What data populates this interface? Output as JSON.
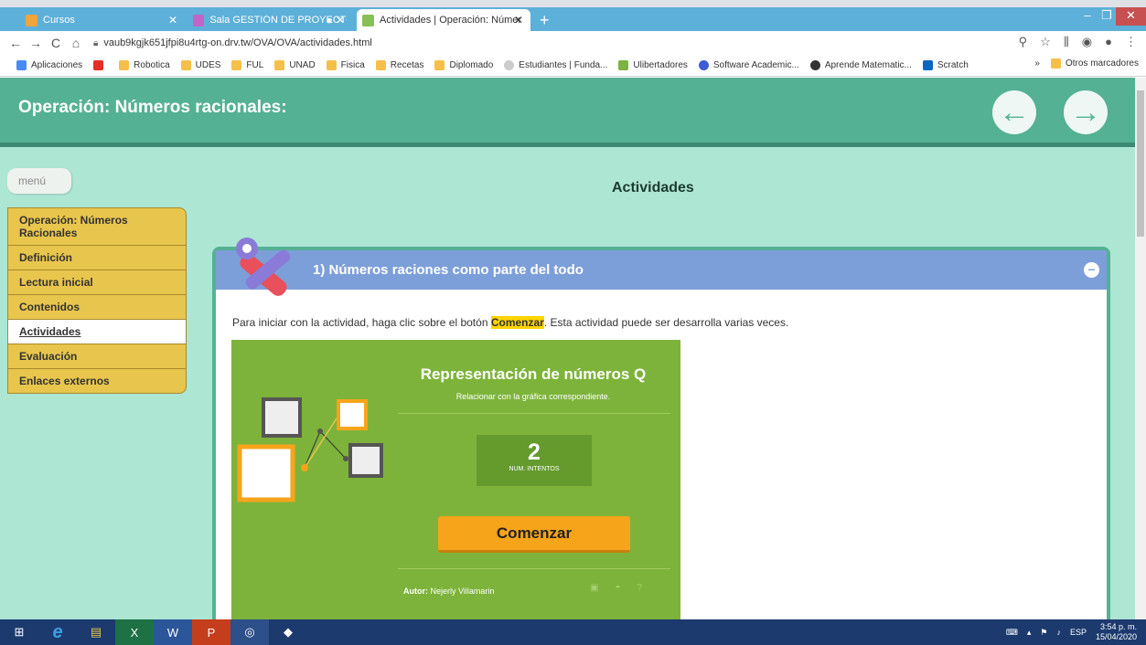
{
  "browser": {
    "tabs": [
      {
        "title": "Cursos",
        "color": "#f2a33a"
      },
      {
        "title": "Sala GESTIÓN DE PROYECTO",
        "color": "#c264c8"
      },
      {
        "title": "Actividades | Operación: Númer",
        "color": "#88c057"
      }
    ],
    "url": "vaub9kgjk651jfpi8u4rtg-on.drv.tw/OVA/OVA/actividades.html",
    "bookmarks": [
      "Aplicaciones",
      "Robotica",
      "UDES",
      "FUL",
      "UNAD",
      "Fisica",
      "Recetas",
      "Diplomado",
      "Estudiantes | Funda...",
      "Ulibertadores",
      "Software Academic...",
      "Aprende Matematic...",
      "Scratch"
    ],
    "other_bookmarks": "Otros marcadores"
  },
  "page": {
    "title": "Operación: Números racionales:",
    "menu_button": "menú",
    "section_title": "Actividades",
    "menu_items": [
      "Operación: Números Racionales",
      "Definición",
      "Lectura inicial",
      "Contenidos",
      "Actividades",
      "Evaluación",
      "Enlaces externos"
    ],
    "active_menu_item": "Actividades"
  },
  "activity": {
    "heading": "1) Números raciones como parte del todo",
    "intro_before": "Para iniciar con la actividad, haga clic sobre el botón ",
    "intro_highlight": "Comenzar",
    "intro_after": ". Esta actividad puede ser desarrolla varias veces.",
    "game": {
      "title": "Representación de números Q",
      "subtitle": "Relacionar con la gráfica correspondiente.",
      "attempts_value": "2",
      "attempts_label": "NUM. INTENTOS",
      "start_button": "Comenzar",
      "author_label": "Autor:",
      "author_name": "Nejerly Villamarin"
    }
  },
  "taskbar": {
    "language": "ESP",
    "time": "3:54 p. m.",
    "date": "15/04/2020"
  }
}
